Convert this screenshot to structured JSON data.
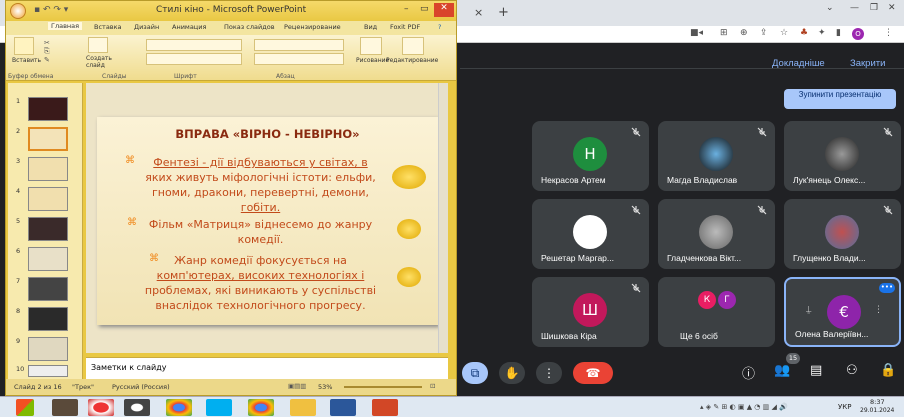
{
  "chrome": {
    "tab_close": "×",
    "new_tab": "+",
    "title_pp": "Стилі кіно - Microsoft PowerPoint"
  },
  "meet": {
    "details_label": "Докладніше",
    "close_label": "Закрити",
    "stop_presenting": "Зупинити презентацію",
    "participants_badge": "15",
    "tiles": [
      {
        "name": "Некрасов Артем",
        "initial": "Н",
        "color": "#1e8e3e"
      },
      {
        "name": "Магда Владислав",
        "initial": "",
        "color": "#111111"
      },
      {
        "name": "Лук'янець Олекс...",
        "initial": "",
        "color": "#222222"
      },
      {
        "name": "Решетар Маргар...",
        "initial": "",
        "color": "#ffffff"
      },
      {
        "name": "Гладченкова Вікт...",
        "initial": "",
        "color": "#6b6b6b"
      },
      {
        "name": "Глущенко Влади...",
        "initial": "",
        "color": "#5470a0"
      },
      {
        "name": "Шишкова Кіра",
        "initial": "Ш",
        "color": "#c2185b"
      },
      {
        "name": "Ще 6 осіб",
        "initial": "",
        "color": ""
      },
      {
        "name": "Олена Валеріївн...",
        "initial": "",
        "color": "#8e24aa"
      }
    ],
    "more_initials": [
      "К",
      "Г"
    ]
  },
  "ppt": {
    "title": "Стилі кіно - Microsoft PowerPoint",
    "ribbon_tabs": [
      "Главная",
      "Вставка",
      "Дизайн",
      "Анимация",
      "Показ слайдов",
      "Рецензирование",
      "Вид",
      "Foxit PDF"
    ],
    "groups": [
      "Буфер обмена",
      "Слайды",
      "Шрифт",
      "Абзац",
      "Рисование",
      "Редактирование"
    ],
    "btn_paste": "Вставить",
    "btn_create": "Создать слайд",
    "btn_draw": "Рисование",
    "btn_edit": "Редактирование",
    "slide_numbers": [
      "1",
      "2",
      "3",
      "4",
      "5",
      "6",
      "7",
      "8",
      "9",
      "10"
    ],
    "slide": {
      "title": "ВПРАВА «ВІРНО - НЕВІРНО»",
      "b1_line1": "Фентезі - дії відбуваються у світах, в",
      "b1_line2": "яких живуть міфологічні істоти: ельфи,",
      "b1_line3": "гноми, дракони, перевертні, демони,",
      "b1_line4": "гобіти.",
      "b2_line1": "Фільм «Матриця» віднесемо до жанру",
      "b2_line2": "комедії.",
      "b3_line1": "Жанр комедії фокусується на",
      "b3_line2": "комп'ютерах, високих технологіях і",
      "b3_line3": "проблемах, які виникають у суспільстві",
      "b3_line4": "внаслідок технологічного прогресу."
    },
    "notes": "Заметки к слайду",
    "status_slide": "Слайд 2 из 16",
    "status_theme": "\"Трек\"",
    "status_lang": "Русский (Россия)",
    "zoom": "53%"
  },
  "taskbar": {
    "lang": "УКР",
    "time": "8:37",
    "date": "29.01.2024"
  }
}
